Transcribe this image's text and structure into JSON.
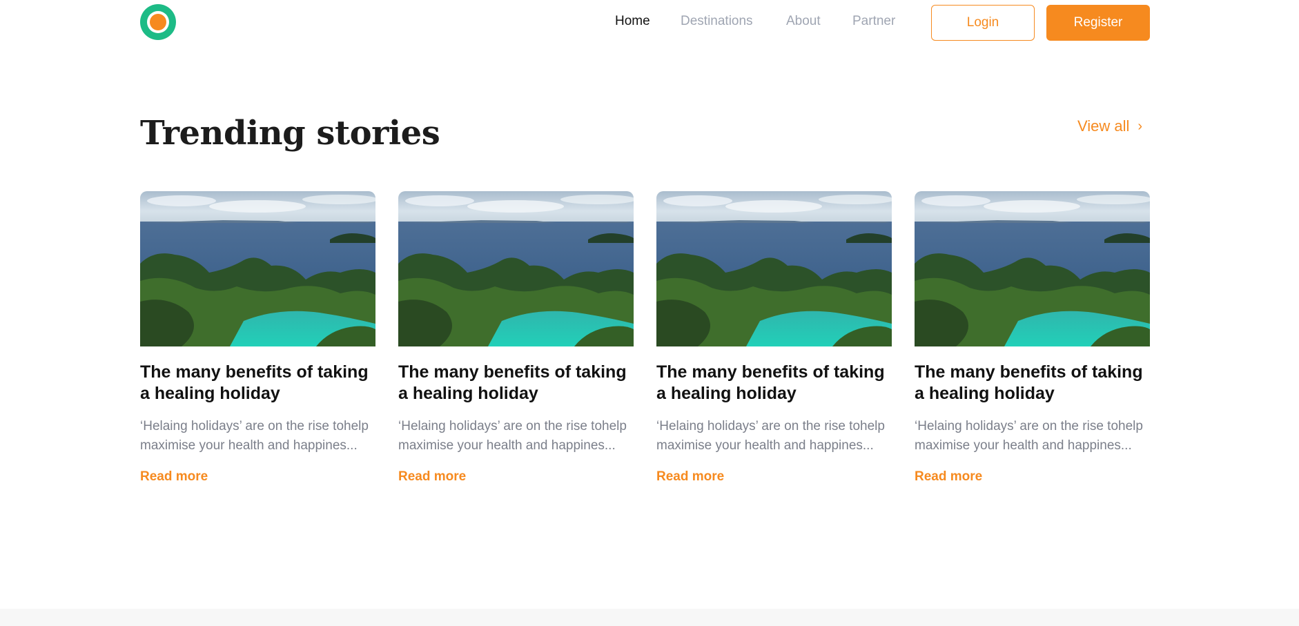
{
  "header": {
    "logo": {
      "icon": "ring-logo-icon",
      "outer_color": "#1dbb86",
      "inner_color": "#f68a1f"
    },
    "nav": [
      {
        "label": "Home",
        "active": true
      },
      {
        "label": "Destinations",
        "active": false
      },
      {
        "label": "About",
        "active": false
      },
      {
        "label": "Partner",
        "active": false
      }
    ],
    "login_label": "Login",
    "register_label": "Register"
  },
  "section": {
    "title": "Trending stories",
    "view_all_label": "View all",
    "view_all_icon": "chevron-right-icon"
  },
  "cards": [
    {
      "title": "The many benefits of taking a healing holiday",
      "excerpt": "‘Helaing holidays’ are on the rise tohelp maximise your health and happines...",
      "link": "Read more"
    },
    {
      "title": "The many benefits of taking a healing holiday",
      "excerpt": "‘Helaing holidays’ are on the rise tohelp maximise your health and happines...",
      "link": "Read more"
    },
    {
      "title": "The many benefits of taking a healing holiday",
      "excerpt": "‘Helaing holidays’ are on the rise tohelp maximise your health and happines...",
      "link": "Read more"
    },
    {
      "title": "The many benefits of taking a healing holiday",
      "excerpt": "‘Helaing holidays’ are on the rise tohelp maximise your health and happines...",
      "link": "Read more"
    }
  ],
  "colors": {
    "accent": "#f68a1f",
    "brand_green": "#1dbb86",
    "heading": "#1c1c1c",
    "muted_text": "#7b7f8a",
    "nav_inactive": "#9fa5b2"
  }
}
